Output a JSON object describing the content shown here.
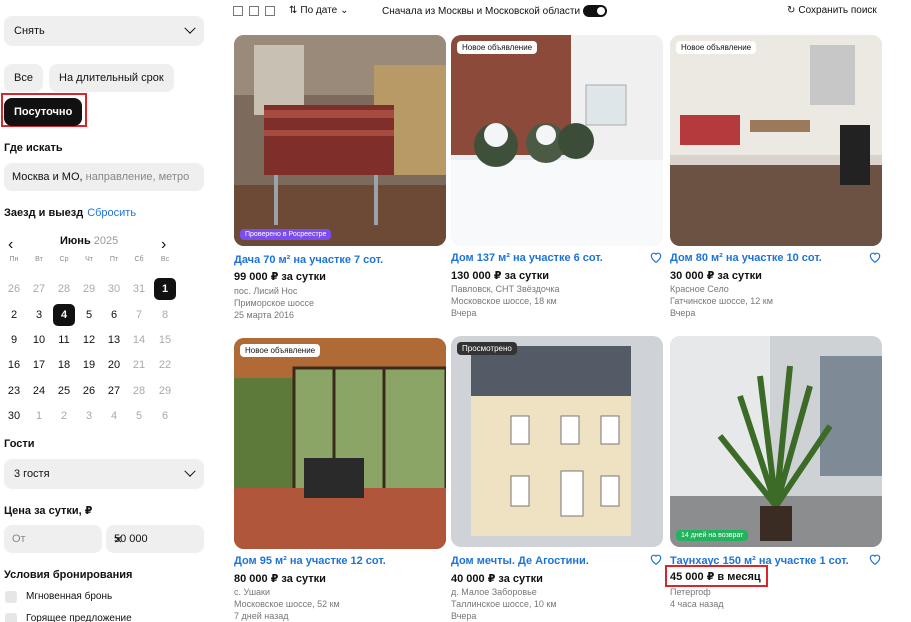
{
  "sidebar": {
    "deal_type": "Снять",
    "chips": [
      "Все",
      "На длительный срок",
      "Посуточно"
    ],
    "where_label": "Где искать",
    "where_value": "Москва и МО,",
    "where_placeholder": "направление, метро",
    "dates_label": "Заезд и выезд",
    "reset_label": "Сбросить",
    "month": "Июнь",
    "year": "2025",
    "weekdays": [
      "Пн",
      "Вт",
      "Ср",
      "Чт",
      "Пт",
      "Сб",
      "Вс"
    ],
    "weeks": [
      [
        "26",
        "27",
        "28",
        "29",
        "30",
        "31",
        "1"
      ],
      [
        "2",
        "3",
        "4",
        "5",
        "6",
        "7",
        "8"
      ],
      [
        "9",
        "10",
        "11",
        "12",
        "13",
        "14",
        "15"
      ],
      [
        "16",
        "17",
        "18",
        "19",
        "20",
        "21",
        "22"
      ],
      [
        "23",
        "24",
        "25",
        "26",
        "27",
        "28",
        "29"
      ],
      [
        "30",
        "1",
        "2",
        "3",
        "4",
        "5",
        "6"
      ]
    ],
    "guests_label": "Гости",
    "guests_value": "3 гостя",
    "price_label": "Цена за сутки, ₽",
    "price_from_placeholder": "От",
    "price_to_value": "50 000",
    "conditions_label": "Условия бронирования",
    "conditions": [
      "Мгновенная бронь",
      "Горящее предложение"
    ]
  },
  "toolbar": {
    "sort_label": "По дате",
    "moscow_toggle_label": "Сначала из Москвы и Московской области",
    "save_search_label": "Сохранить поиск"
  },
  "listings": [
    {
      "badge": "",
      "bottom_badge": "Проверено в Росреестре",
      "title": "Дача 70 м² на участке 7 сот.",
      "price": "99 000 ₽ за сутки",
      "lines": [
        "пос. Лисий Нос",
        "Приморское шоссе",
        "25 марта 2016"
      ]
    },
    {
      "badge": "Новое объявление",
      "bottom_badge": "",
      "title": "Дом 137 м² на участке 6 сот.",
      "price": "130 000 ₽ за сутки",
      "lines": [
        "Павловск, СНТ Звёздочка",
        "Московское шоссе, 18 км",
        "Вчера"
      ]
    },
    {
      "badge": "Новое объявление",
      "bottom_badge": "",
      "title": "Дом 80 м² на участке 10 сот.",
      "price": "30 000 ₽ за сутки",
      "lines": [
        "Красное Село",
        "Гатчинское шоссе, 12 км",
        "Вчера"
      ]
    },
    {
      "badge": "Новое объявление",
      "bottom_badge": "",
      "title": "Дом 95 м² на участке 12 сот.",
      "price": "80 000 ₽ за сутки",
      "lines": [
        "с. Ушаки",
        "Московское шоссе, 52 км",
        "7 дней назад"
      ]
    },
    {
      "badge": "Просмотрено",
      "bottom_badge": "",
      "title": "Дом мечты. Де Агостини.",
      "price": "40 000 ₽ за сутки",
      "lines": [
        "д. Малое Заборовье",
        "Таллинское шоссе, 10 км",
        "Вчера"
      ]
    },
    {
      "badge": "",
      "bottom_badge": "14 дней на возврат",
      "title": "Таунхаус 150 м² на участке 1 сот.",
      "price": "45 000 ₽ в месяц",
      "lines": [
        "Петергоф",
        "4 часа назад"
      ]
    }
  ],
  "colors": {
    "link": "#1e73d8",
    "highlight": "#d9252c",
    "purple_badge": "#7b4cf2",
    "green_badge": "#22b35e"
  }
}
